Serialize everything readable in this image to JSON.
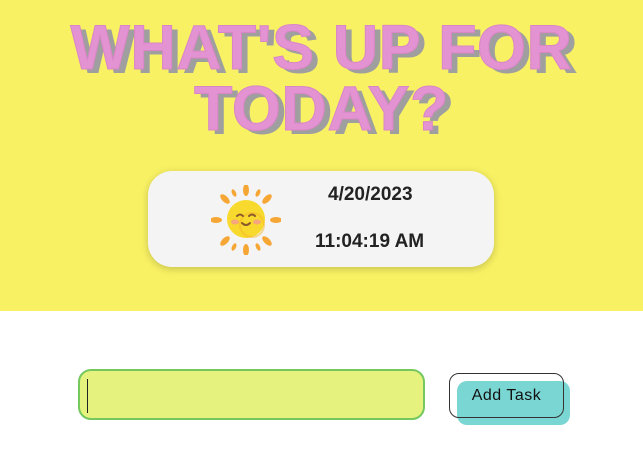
{
  "header": {
    "title_line_1": "WHAT'S UP FOR",
    "title_line_2": "TODAY?"
  },
  "clock": {
    "icon": "sun-icon",
    "date": "4/20/2023",
    "time": "11:04:19 AM"
  },
  "task_entry": {
    "input_value": "",
    "placeholder": "",
    "add_button_label": "Add Task"
  },
  "colors": {
    "hero_background": "#f8f163",
    "title_fill": "#e392d2",
    "title_shadow": "#9f9f9f",
    "card_background": "#f4f4f4",
    "input_background": "#e5f37e",
    "input_border": "#75c85d",
    "button_accent": "#7ad6d3"
  }
}
